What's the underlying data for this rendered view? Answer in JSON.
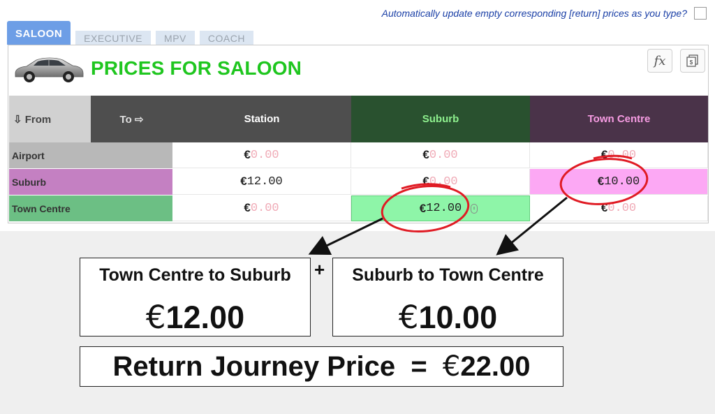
{
  "options": {
    "auto_update_label": "Automatically update empty corresponding [return] prices as you type?",
    "auto_update_checked": false
  },
  "tabs": [
    {
      "label": "SALOON",
      "active": true
    },
    {
      "label": "EXECUTIVE",
      "active": false
    },
    {
      "label": "MPV",
      "active": false
    },
    {
      "label": "COACH",
      "active": false
    }
  ],
  "panel": {
    "title": "PRICES FOR SALOON",
    "car_icon": "saloon-car-icon",
    "tools": [
      "formula-icon",
      "calculator-icon"
    ]
  },
  "table": {
    "from_header": "⇩ From",
    "to_header": "To ⇨",
    "columns": [
      {
        "label": "Station",
        "bg": "#4e4e4e",
        "color": "#ffffff"
      },
      {
        "label": "Suburb",
        "bg": "#29512f",
        "color": "#8ef08e"
      },
      {
        "label": "Town Centre",
        "bg": "#4a3349",
        "color": "#f79ce3"
      }
    ],
    "currency": "€",
    "rows": [
      {
        "label": "Airport",
        "label_bg": "#b8b8b8",
        "row_bg": "#ffffff",
        "cells": [
          {
            "value": "0.00",
            "empty": true
          },
          {
            "value": "0.00",
            "empty": true
          },
          {
            "value": "0.00",
            "empty": true
          }
        ]
      },
      {
        "label": "Suburb",
        "label_bg": "#c480c2",
        "row_bg": "#ffffff",
        "cells": [
          {
            "value": "12.00",
            "empty": false
          },
          {
            "value": "0.00",
            "empty": true
          },
          {
            "value": "10.00",
            "empty": false,
            "highlight": "#fca8f4"
          }
        ]
      },
      {
        "label": "Town Centre",
        "label_bg": "#6cbf84",
        "row_bg": "#ffffff",
        "cells": [
          {
            "value": "0.00",
            "empty": true
          },
          {
            "value": "12.00",
            "empty": false,
            "highlight": "#8ef5a8",
            "focused": true
          },
          {
            "value": "0.00",
            "empty": true
          }
        ]
      }
    ]
  },
  "summary": {
    "box1_title": "Town Centre to Suburb",
    "box1_amount": "12.00",
    "box2_title": "Suburb to Town Centre",
    "box2_amount": "10.00",
    "plus": "+",
    "return_label": "Return Journey Price  =  ",
    "return_amount": "22.00",
    "euro": "€"
  }
}
